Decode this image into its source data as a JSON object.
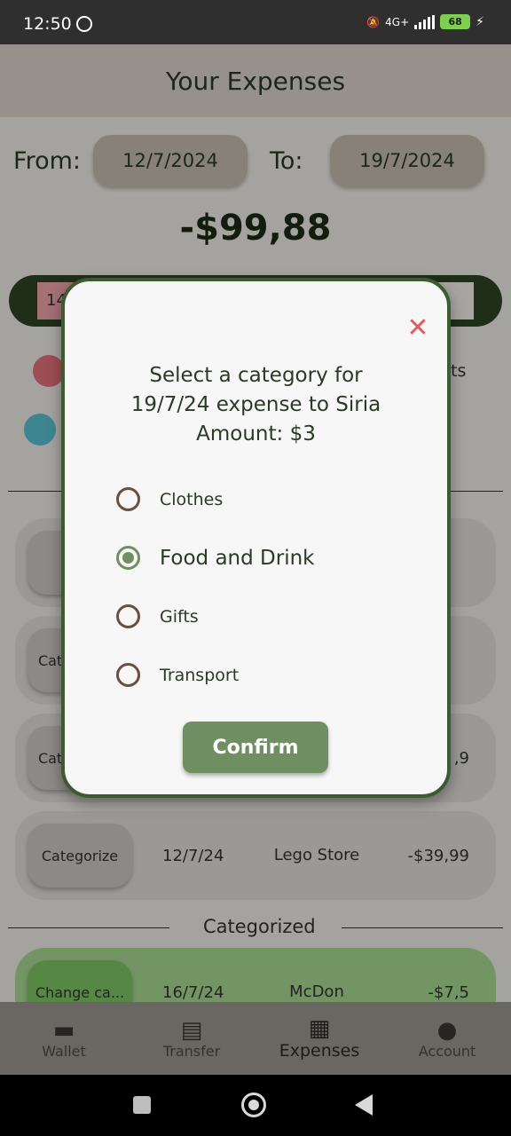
{
  "status_bar": {
    "time": "12:50",
    "network": "4G+",
    "battery": "68"
  },
  "app_bar": {
    "title": "Your Expenses"
  },
  "date_range": {
    "from_label": "From:",
    "from_value": "12/7/2024",
    "to_label": "To:",
    "to_value": "19/7/2024"
  },
  "total": "-$99,88",
  "progress": {
    "label": "14",
    "fraction": 0.14,
    "fill_color": "#f2a7ad"
  },
  "legend": [
    {
      "color": "#e8747c",
      "text": ""
    },
    {
      "color": "#5bc6d6",
      "text": ""
    }
  ],
  "legend_partial_text": "ts",
  "uncategorized_cards": [
    {
      "button": "",
      "date": "",
      "merchant": "",
      "amount": ""
    },
    {
      "button": "Cat",
      "date": "",
      "merchant": "",
      "amount": ""
    },
    {
      "button": "Cat",
      "date": "",
      "merchant": "",
      "amount": ",9"
    },
    {
      "button": "Categorize",
      "date": "12/7/24",
      "merchant": "Lego Store",
      "amount": "-$39,99"
    }
  ],
  "categorized_section": {
    "title": "Categorized"
  },
  "categorized_cards": [
    {
      "button": "Change ca...",
      "date": "16/7/24",
      "merchant": "McDon",
      "amount": "-$7,5"
    }
  ],
  "bottom_nav": [
    {
      "label": "Wallet",
      "icon": "wallet-icon",
      "active": false
    },
    {
      "label": "Transfer",
      "icon": "chat-icon",
      "active": false
    },
    {
      "label": "Expenses",
      "icon": "receipt-icon",
      "active": true
    },
    {
      "label": "Account",
      "icon": "account-icon",
      "active": false
    }
  ],
  "dialog": {
    "title_line1": "Select a category for",
    "title_line2": "19/7/24 expense to Siria",
    "title_line3": "Amount: $3",
    "close_icon": "close-icon",
    "options": [
      {
        "label": "Clothes",
        "selected": false
      },
      {
        "label": "Food and Drink",
        "selected": true
      },
      {
        "label": "Gifts",
        "selected": false
      },
      {
        "label": "Transport",
        "selected": false
      }
    ],
    "confirm_label": "Confirm"
  },
  "colors": {
    "accent_green": "#6f8f62",
    "dark_green": "#3d5a30",
    "close_red": "#e35b6a"
  }
}
